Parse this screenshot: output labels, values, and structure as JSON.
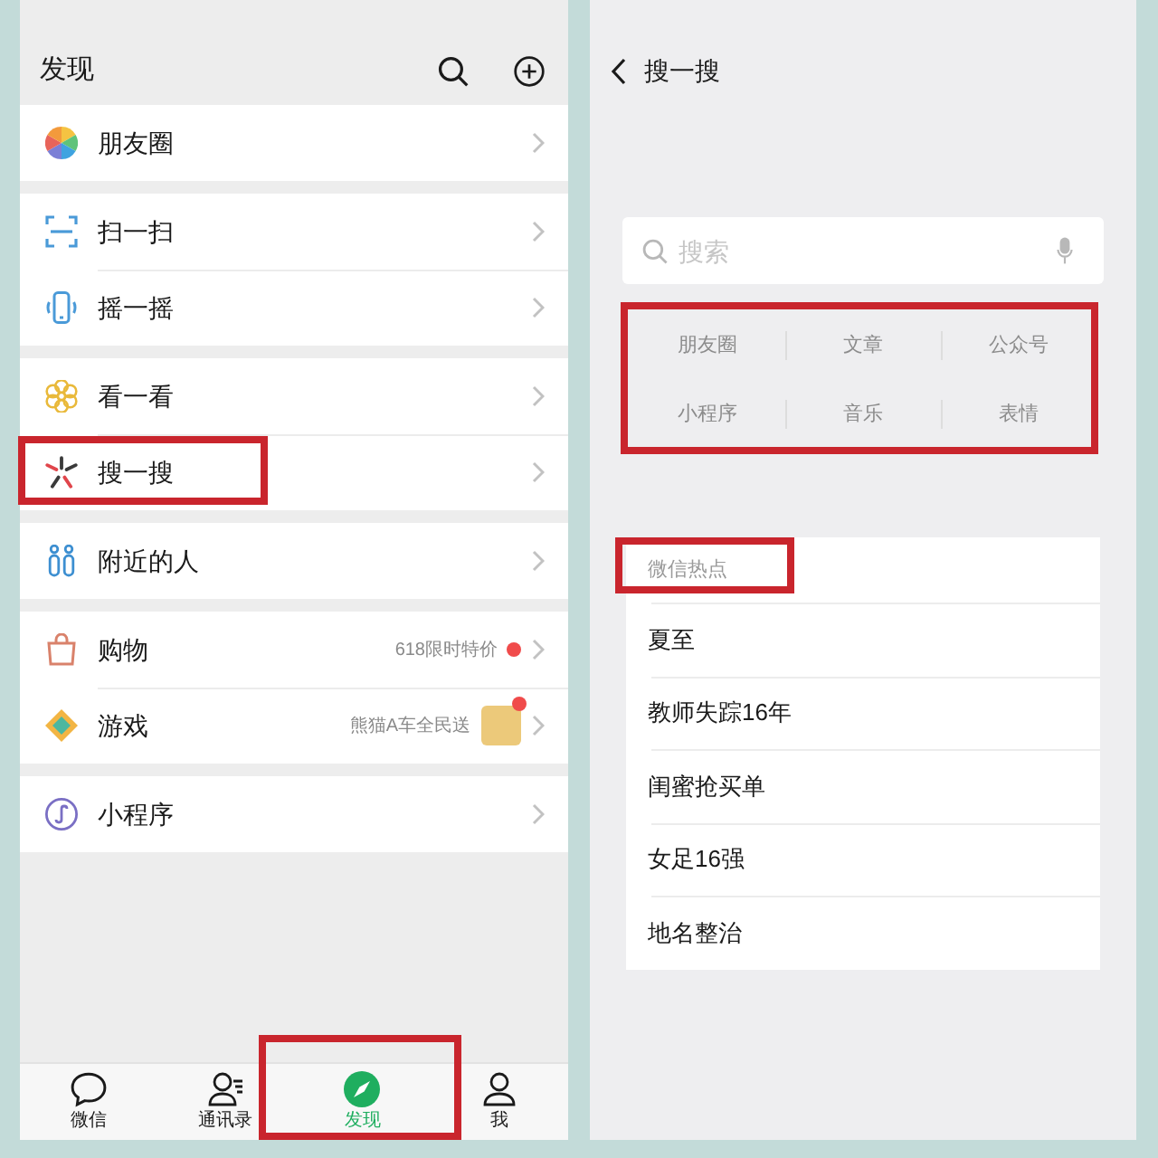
{
  "left_screen": {
    "header": {
      "title": "发现"
    },
    "groups": [
      {
        "items": [
          {
            "label": "朋友圈",
            "highlighted": false,
            "dot": false
          }
        ]
      },
      {
        "items": [
          {
            "label": "扫一扫",
            "highlighted": false,
            "dot": false
          },
          {
            "label": "摇一摇",
            "highlighted": false,
            "dot": false
          }
        ]
      },
      {
        "items": [
          {
            "label": "看一看",
            "highlighted": false,
            "dot": false
          },
          {
            "label": "搜一搜",
            "highlighted": true,
            "dot": false
          }
        ]
      },
      {
        "items": [
          {
            "label": "附近的人",
            "highlighted": false,
            "dot": false
          }
        ]
      },
      {
        "items": [
          {
            "label": "购物",
            "badge_text": "618限时特价",
            "highlighted": false,
            "dot": true
          },
          {
            "label": "游戏",
            "badge_text": "熊猫A车全民送",
            "thumbnail": true,
            "highlighted": false,
            "dot": true
          }
        ]
      },
      {
        "items": [
          {
            "label": "小程序",
            "highlighted": false,
            "dot": false
          }
        ]
      }
    ],
    "tab_bar": [
      {
        "label": "微信",
        "selected": false,
        "highlighted": false
      },
      {
        "label": "通讯录",
        "selected": false,
        "highlighted": false
      },
      {
        "label": "发现",
        "selected": true,
        "highlighted": true
      },
      {
        "label": "我",
        "selected": false,
        "highlighted": false
      }
    ]
  },
  "right_screen": {
    "header": {
      "title": "搜一搜"
    },
    "search": {
      "placeholder": "搜索"
    },
    "categories": {
      "highlighted": true,
      "items": [
        "朋友圈",
        "文章",
        "公众号",
        "小程序",
        "音乐",
        "表情"
      ]
    },
    "hot_list": {
      "title": "微信热点",
      "highlighted": true,
      "items": [
        "夏至",
        "教师失踪16年",
        "闺蜜抢买单",
        "女足16强",
        "地名整治"
      ]
    }
  }
}
